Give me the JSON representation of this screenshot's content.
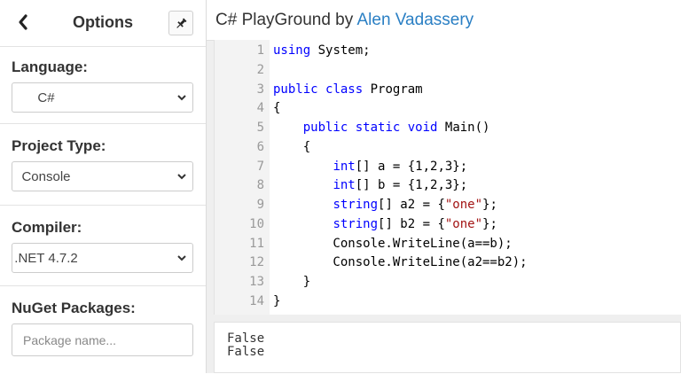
{
  "sidebar": {
    "title": "Options",
    "icons": {
      "back": "chevron-left-icon",
      "pin": "pin-icon"
    },
    "language": {
      "label": "Language:",
      "value": "C#"
    },
    "project_type": {
      "label": "Project Type:",
      "value": "Console"
    },
    "compiler": {
      "label": "Compiler:",
      "value": ".NET 4.7.2"
    },
    "nuget": {
      "label": "NuGet Packages:",
      "placeholder": "Package name..."
    }
  },
  "header": {
    "title": "C# PlayGround by ",
    "author": "Alen Vadassery",
    "link_color": "#2a7fc4"
  },
  "editor": {
    "lines": [
      {
        "n": "1",
        "code": "using System;"
      },
      {
        "n": "2",
        "code": ""
      },
      {
        "n": "3",
        "code": "public class Program"
      },
      {
        "n": "4",
        "code": "{"
      },
      {
        "n": "5",
        "code": "    public static void Main()"
      },
      {
        "n": "6",
        "code": "    {"
      },
      {
        "n": "7",
        "code": "        int[] a = {1,2,3};"
      },
      {
        "n": "8",
        "code": "        int[] b = {1,2,3};"
      },
      {
        "n": "9",
        "code": "        string[] a2 = {\"one\"};"
      },
      {
        "n": "10",
        "code": "        string[] b2 = {\"one\"};"
      },
      {
        "n": "11",
        "code": "        Console.WriteLine(a==b);"
      },
      {
        "n": "12",
        "code": "        Console.WriteLine(a2==b2);"
      },
      {
        "n": "13",
        "code": "    }"
      },
      {
        "n": "14",
        "code": "}"
      }
    ],
    "keywords": [
      "using",
      "public",
      "class",
      "static",
      "void",
      "int",
      "string"
    ],
    "colors": {
      "keyword": "#0000ff",
      "string": "#a31515",
      "gutter": "#f3f3f3"
    }
  },
  "output": {
    "lines": [
      "False",
      "False"
    ]
  }
}
